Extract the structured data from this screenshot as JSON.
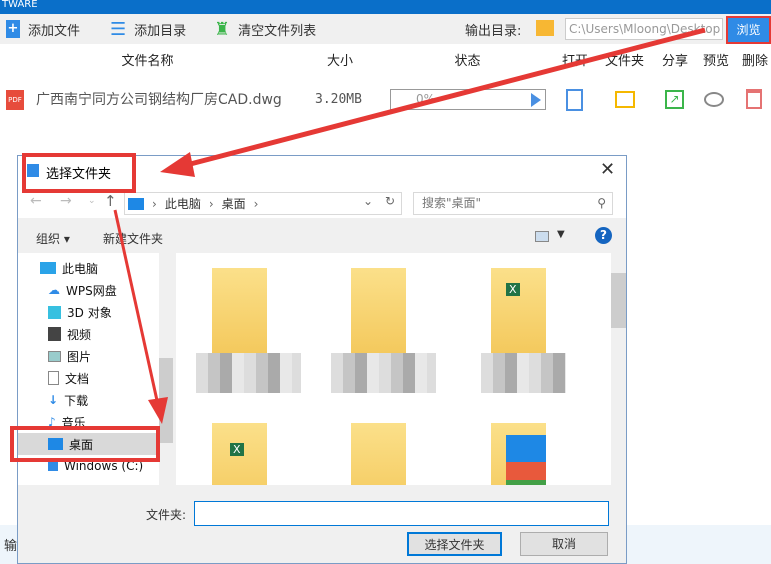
{
  "app": {
    "title_fragment": "TWARE"
  },
  "toolbar": {
    "add_file": "添加文件",
    "add_dir": "添加目录",
    "clear_list": "清空文件列表",
    "output_label": "输出目录:",
    "output_path": "C:\\Users\\Mloong\\Desktop",
    "browse": "浏览"
  },
  "table": {
    "headers": [
      "文件名称",
      "大小",
      "状态",
      "打开",
      "文件夹",
      "分享",
      "预览",
      "删除"
    ],
    "rows": [
      {
        "icon": "PDF",
        "name": "广西南宁同方公司钢结构厂房CAD.dwg",
        "size": "3.20MB",
        "progress": "0%"
      }
    ]
  },
  "bottom_partial": "输",
  "dialog": {
    "title": "选择文件夹",
    "breadcrumb": [
      "此电脑",
      "桌面"
    ],
    "search_placeholder": "搜索\"桌面\"",
    "organize": "组织",
    "new_folder": "新建文件夹",
    "nav": [
      "此电脑",
      "WPS网盘",
      "3D 对象",
      "视频",
      "图片",
      "文档",
      "下载",
      "音乐",
      "桌面",
      "Windows (C:)"
    ],
    "selected_nav": "桌面",
    "folder_label": "文件夹:",
    "folder_value": "",
    "ok": "选择文件夹",
    "cancel": "取消"
  },
  "colors": {
    "accent": "#2f8be6",
    "annotation": "#e53935",
    "titlebar": "#0a6fc9"
  }
}
